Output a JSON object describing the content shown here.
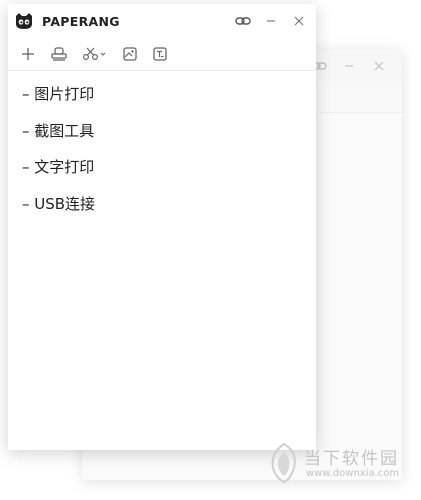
{
  "app": {
    "title": "PAPERANG"
  },
  "toolbar": {
    "items": [
      {
        "icon": "plus-icon"
      },
      {
        "icon": "stamp-print-icon"
      },
      {
        "icon": "scissors-icon"
      },
      {
        "icon": "image-frame-icon"
      },
      {
        "icon": "text-box-icon"
      }
    ]
  },
  "content": {
    "lines": [
      "– 图片打印",
      "– 截图工具",
      "– 文字打印",
      "– USB连接"
    ]
  },
  "watermark": {
    "text": "当下软件园",
    "url": "www.downxia.com"
  },
  "colors": {
    "background": "#ffffff",
    "icon_gray": "#666666",
    "watermark_gray": "#c4c4c4"
  }
}
